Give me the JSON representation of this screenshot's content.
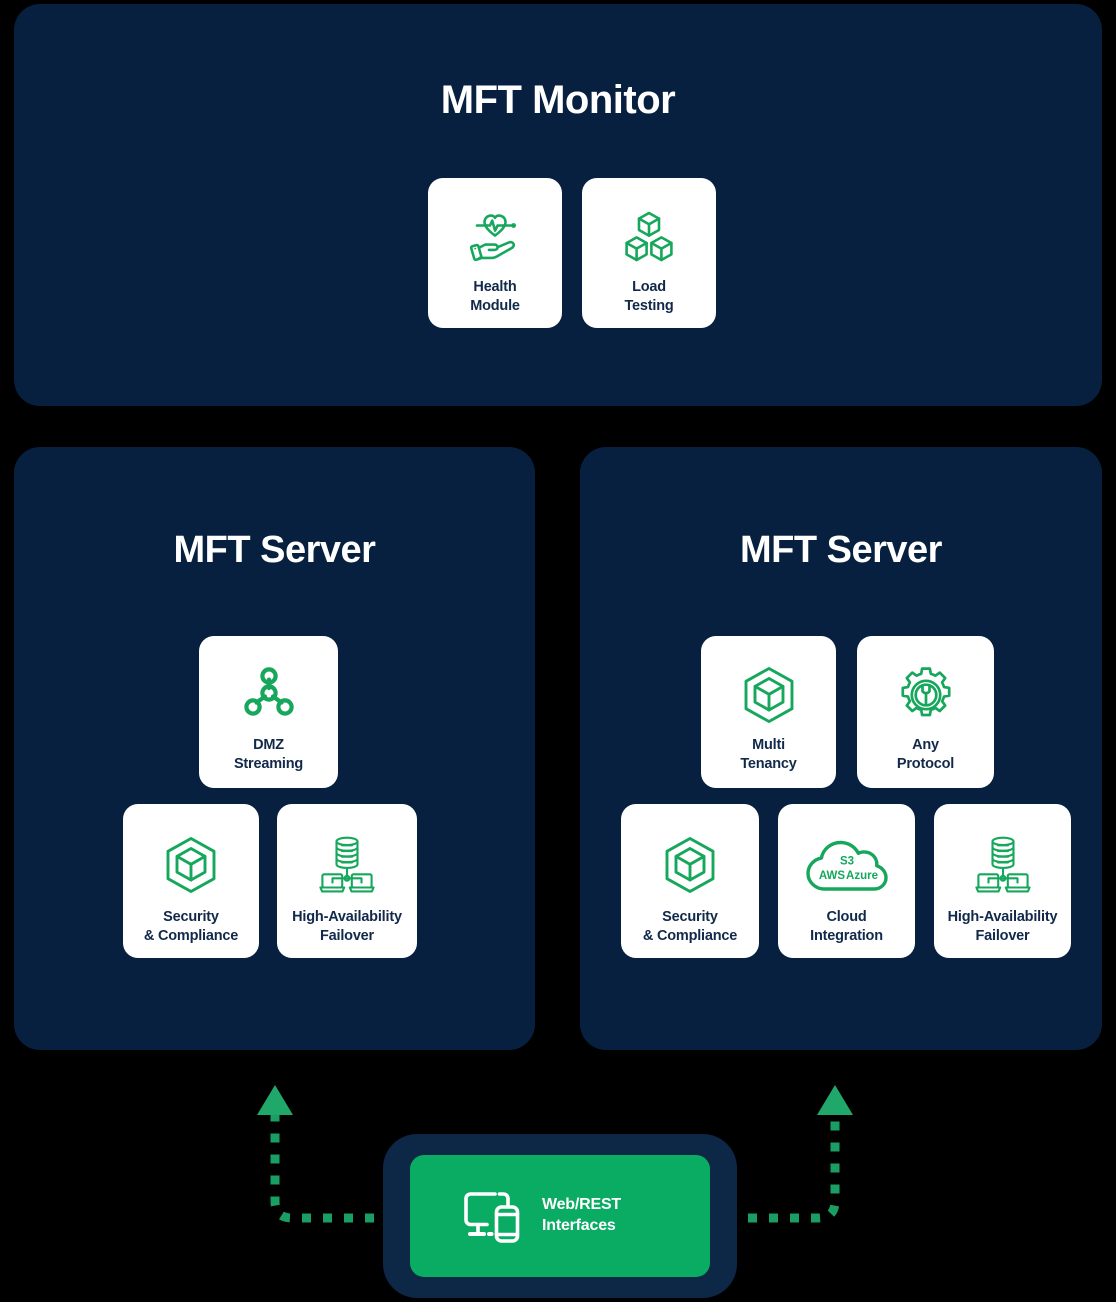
{
  "colors": {
    "background": "#000000",
    "panel": "#07203f",
    "card": "#ffffff",
    "accent_green": "#0aab62",
    "icon_green": "#16a75c",
    "label_navy": "#12294a",
    "title_white": "#ffffff",
    "webrest_outline": "#0d2747"
  },
  "monitor": {
    "title": "MFT Monitor",
    "cards": [
      {
        "id": "health",
        "icon": "heart-hand-icon",
        "label": "Health\nModule"
      },
      {
        "id": "load",
        "icon": "stacked-cubes-icon",
        "label": "Load\nTesting"
      }
    ]
  },
  "server_left": {
    "title": "MFT Server",
    "cards": [
      {
        "id": "dmz",
        "icon": "network-nodes-icon",
        "label": "DMZ\nStreaming"
      },
      {
        "id": "security",
        "icon": "cube-shield-icon",
        "label": "Security\n& Compliance"
      },
      {
        "id": "ha",
        "icon": "database-laptops-icon",
        "label": "High-Availability\nFailover"
      }
    ]
  },
  "server_right": {
    "title": "MFT Server",
    "cards": [
      {
        "id": "multi",
        "icon": "cube-shield-icon",
        "label": "Multi\nTenancy"
      },
      {
        "id": "protocol",
        "icon": "gear-wrench-icon",
        "label": "Any\nProtocol"
      },
      {
        "id": "security",
        "icon": "cube-shield-icon",
        "label": "Security\n& Compliance"
      },
      {
        "id": "cloud",
        "icon": "cloud-icon",
        "label": "Cloud\nIntegration",
        "cloud_top": "S3",
        "cloud_left": "AWS",
        "cloud_right": "Azure"
      },
      {
        "id": "ha",
        "icon": "database-laptops-icon",
        "label": "High-Availability\nFailover"
      }
    ]
  },
  "webrest": {
    "label": "Web/REST\nInterfaces",
    "icon": "monitor-phone-icon"
  },
  "connectors": {
    "left_arrow": "arrow-up-icon",
    "right_arrow": "arrow-up-icon",
    "style": "dotted"
  }
}
